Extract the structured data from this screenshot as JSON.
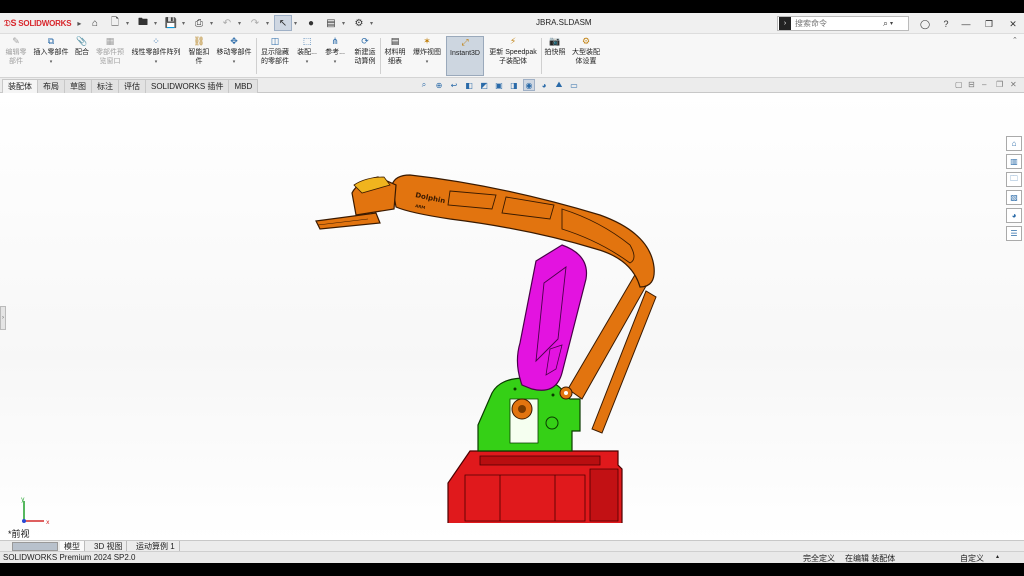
{
  "app": {
    "brand": "SOLIDWORKS",
    "window_title": "JBRA.SLDASM"
  },
  "search": {
    "placeholder": "搜索命令"
  },
  "ribbon": {
    "buttons": [
      {
        "label": "编辑零\n部件",
        "disabled": true
      },
      {
        "label": "插入零部件",
        "dropdown": true
      },
      {
        "label": "配合"
      },
      {
        "label": "零部件预\n览窗口",
        "disabled": true
      },
      {
        "label": "线性零部件阵列",
        "dropdown": true
      },
      {
        "label": "智能扣\n件"
      },
      {
        "label": "移动零部件",
        "dropdown": true
      },
      {
        "label": "显示隐藏\n的零部件"
      },
      {
        "label": "装配...",
        "dropdown": true
      },
      {
        "label": "参考...",
        "dropdown": true
      },
      {
        "label": "新建运\n动算例"
      },
      {
        "label": "材料明\n细表"
      },
      {
        "label": "爆炸视图",
        "dropdown": true
      },
      {
        "label": "Instant3D",
        "active": true
      },
      {
        "label": "更新 Speedpak\n子装配体"
      },
      {
        "label": "拍快照"
      },
      {
        "label": "大型装配\n体设置"
      }
    ]
  },
  "tabs": [
    "装配体",
    "布局",
    "草图",
    "标注",
    "评估",
    "SOLIDWORKS 插件",
    "MBD"
  ],
  "viewport": {
    "view_name": "*前视",
    "robot_label_1": "Dolphin",
    "robot_label_2": "ARM"
  },
  "bottom_tabs": [
    "模型",
    "3D 视图",
    "运动算例 1"
  ],
  "status": {
    "product": "SOLIDWORKS Premium 2024 SP2.0",
    "definition": "完全定义",
    "editing": "在编辑 装配体",
    "custom": "自定义"
  },
  "colors": {
    "base": "#e0191c",
    "shoulder": "#35d016",
    "lower_arm": "#e313e0",
    "upper_arm": "#e2740f",
    "gripper": "#f0b41e"
  }
}
